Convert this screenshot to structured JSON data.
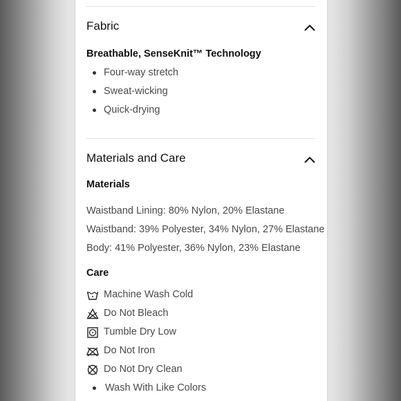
{
  "fabric": {
    "title": "Fabric",
    "subtitle": "Breathable, SenseKnit™ Technology",
    "features": [
      "Four-way stretch",
      "Sweat-wicking",
      "Quick-drying"
    ]
  },
  "materials_care": {
    "title": "Materials and Care",
    "materials_heading": "Materials",
    "materials": [
      "Waistband Lining: 80% Nylon, 20% Elastane",
      "Waistband: 39% Polyester, 34% Nylon, 27% Elastane",
      "Body: 41% Polyester, 36% Nylon, 23% Elastane"
    ],
    "care_heading": "Care",
    "care": [
      {
        "label": "Machine Wash Cold",
        "icon": "machine-wash-cold-icon"
      },
      {
        "label": "Do Not Bleach",
        "icon": "do-not-bleach-icon"
      },
      {
        "label": "Tumble Dry Low",
        "icon": "tumble-dry-low-icon"
      },
      {
        "label": "Do Not Iron",
        "icon": "do-not-iron-icon"
      },
      {
        "label": "Do Not Dry Clean",
        "icon": "do-not-dry-clean-icon"
      },
      {
        "label": "Wash With Like Colors",
        "icon": "bullet"
      }
    ]
  }
}
